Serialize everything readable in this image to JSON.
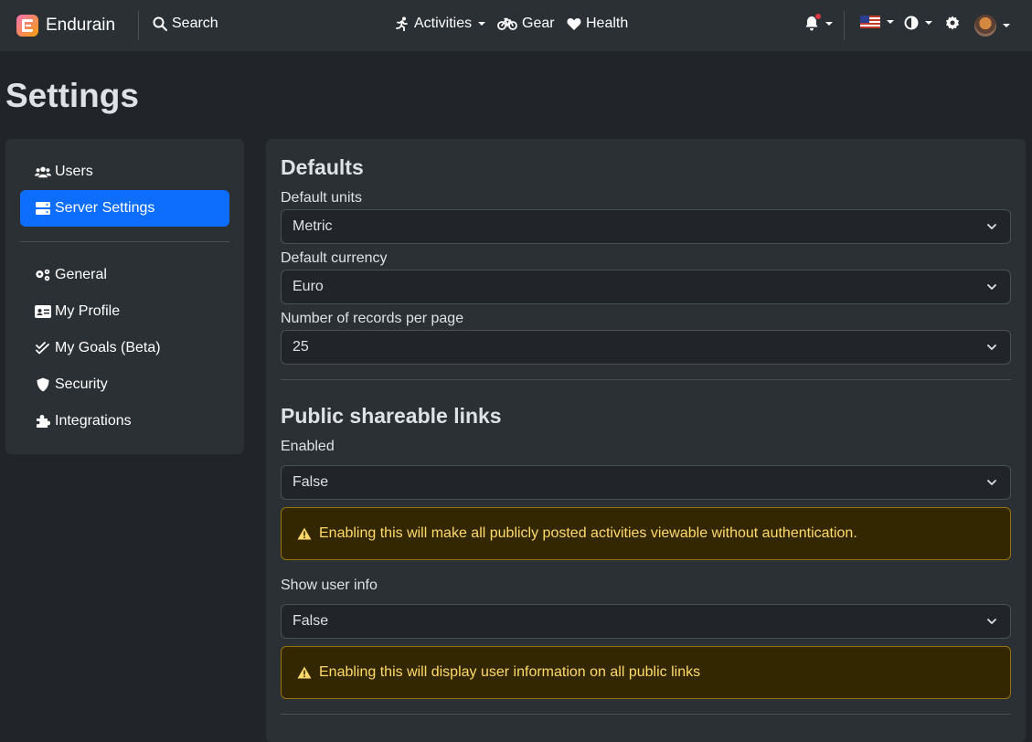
{
  "navbar": {
    "brand": "Endurain",
    "search_label": "Search",
    "activities_label": "Activities",
    "gear_label": "Gear",
    "health_label": "Health"
  },
  "page_title": "Settings",
  "sidebar": {
    "items": [
      {
        "label": "Users",
        "icon": "users-icon"
      },
      {
        "label": "Server Settings",
        "icon": "server-icon",
        "active": true
      },
      {
        "label": "General",
        "icon": "gears-icon"
      },
      {
        "label": "My Profile",
        "icon": "id-card-icon"
      },
      {
        "label": "My Goals (Beta)",
        "icon": "check-double-icon"
      },
      {
        "label": "Security",
        "icon": "shield-icon"
      },
      {
        "label": "Integrations",
        "icon": "puzzle-icon"
      }
    ]
  },
  "defaults": {
    "title": "Defaults",
    "units_label": "Default units",
    "units_value": "Metric",
    "currency_label": "Default currency",
    "currency_value": "Euro",
    "records_label": "Number of records per page",
    "records_value": "25"
  },
  "public_links": {
    "title": "Public shareable links",
    "enabled_label": "Enabled",
    "enabled_value": "False",
    "enabled_warning": "Enabling this will make all publicly posted activities viewable without authentication.",
    "user_info_label": "Show user info",
    "user_info_value": "False",
    "user_info_warning": "Enabling this will display user information on all public links"
  },
  "colors": {
    "accent": "#0d6efd",
    "background": "#212529",
    "panel": "#2b3035",
    "warning_bg": "#332701",
    "warning_text": "#ffda6a",
    "notification_dot": "#dc3545"
  }
}
